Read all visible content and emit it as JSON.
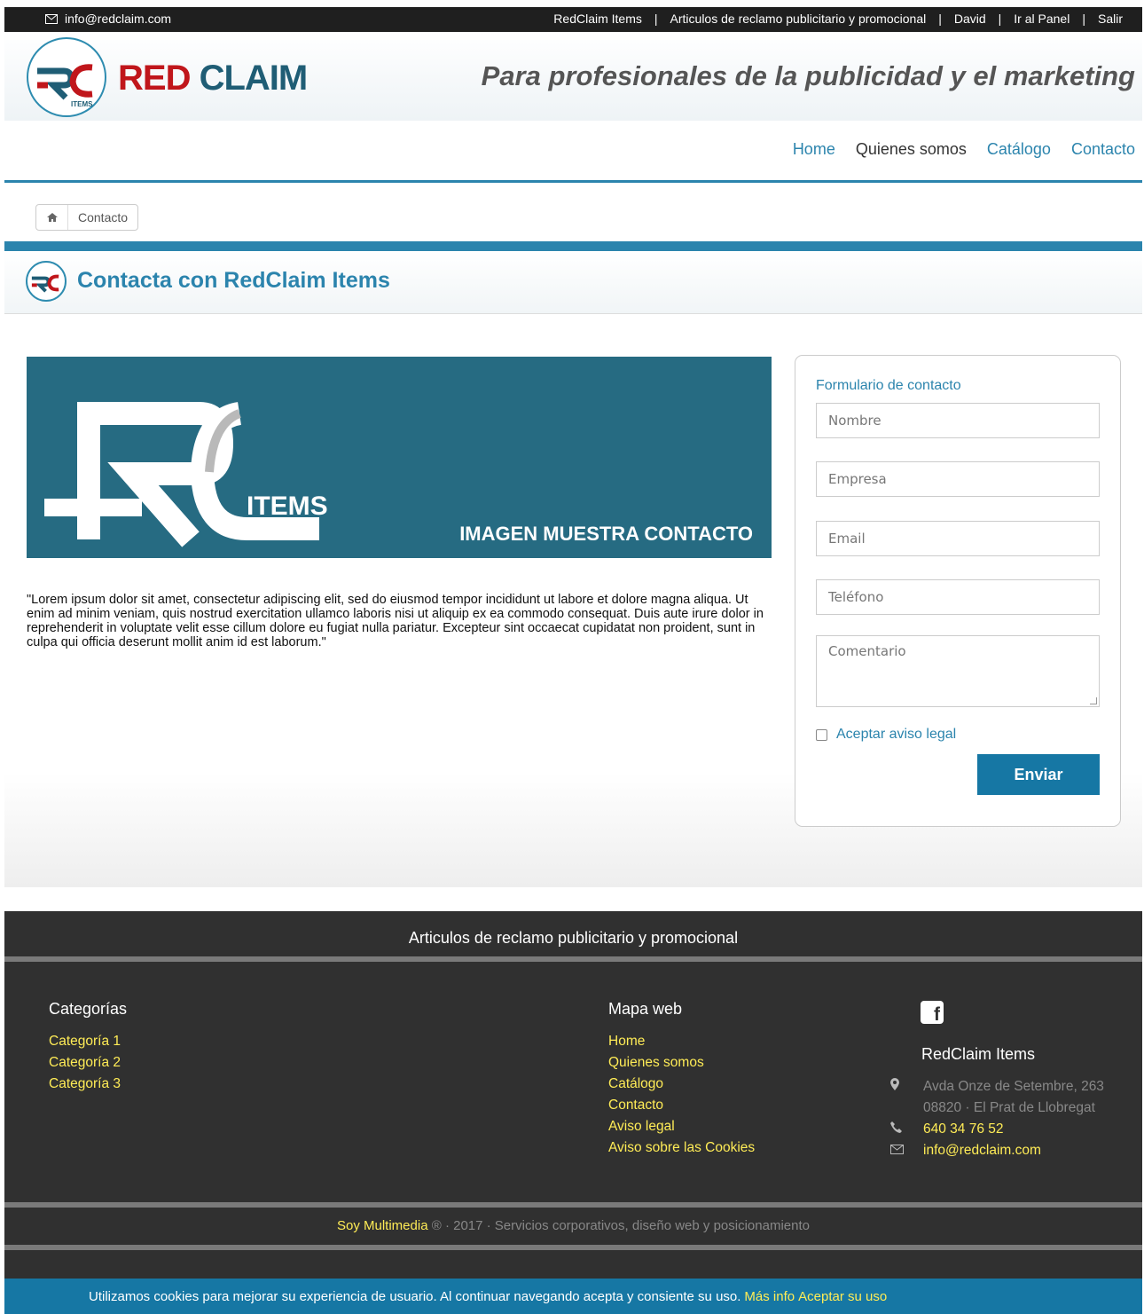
{
  "topbar": {
    "email": "info@redclaim.com",
    "links": [
      "RedClaim Items",
      "|",
      "Articulos de reclamo publicitario y promocional",
      "|",
      "David",
      "|",
      "Ir al Panel",
      "|",
      "Salir"
    ]
  },
  "header": {
    "logo_red": "RED",
    "logo_blue": "CLAIM",
    "logo_badge": "ITEMS",
    "tagline": "Para profesionales de la publicidad y el marketing"
  },
  "nav": {
    "items": [
      "Home",
      "Quienes somos",
      "Catálogo",
      "Contacto"
    ],
    "active_index": 1
  },
  "breadcrumb": {
    "current": "Contacto"
  },
  "page": {
    "title": "Contacta con RedClaim Items"
  },
  "banner": {
    "items_text": "ITEMS",
    "caption": "IMAGEN MUESTRA CONTACTO"
  },
  "lorem": "\"Lorem ipsum dolor sit amet, consectetur adipiscing elit, sed do eiusmod tempor incididunt ut labore et dolore magna aliqua. Ut enim ad minim veniam, quis nostrud exercitation ullamco laboris nisi ut aliquip ex ea commodo consequat. Duis aute irure dolor in reprehenderit in voluptate velit esse cillum dolore eu fugiat nulla pariatur. Excepteur sint occaecat cupidatat non proident, sunt in culpa qui officia deserunt mollit anim id est laborum.\"",
  "form": {
    "title": "Formulario de contacto",
    "nombre": "Nombre",
    "empresa": "Empresa",
    "email": "Email",
    "telefono": "Teléfono",
    "comentario": "Comentario",
    "legal": "Aceptar aviso legal",
    "submit": "Enviar"
  },
  "footer": {
    "band": "Articulos de reclamo publicitario y promocional",
    "categories_title": "Categorías",
    "categories": [
      "Categoría 1",
      "Categoría 2",
      "Categoría 3"
    ],
    "sitemap_title": "Mapa web",
    "sitemap": [
      "Home",
      "Quienes somos",
      "Catálogo",
      "Contacto",
      "Aviso legal",
      "Aviso sobre las Cookies"
    ],
    "company": "RedClaim Items",
    "address1": "Avda Onze de Setembre, 263",
    "address2": "08820 · El Prat de Llobregat",
    "phone": "640 34 76 52",
    "email": "info@redclaim.com",
    "copy_brand": "Soy Multimedia",
    "copy_rest": "® · 2017 · Servicios corporativos, diseño web y posicionamiento"
  },
  "cookies": {
    "text": "Utilizamos cookies para mejorar su experiencia de usuario. Al continuar navegando acepta y consiente su uso.",
    "more": "Más info",
    "accept": "Aceptar su uso"
  },
  "colors": {
    "accent": "#2b84ad",
    "brand_red": "#c0161b",
    "footer_link": "#ffec56",
    "button": "#1677a4"
  }
}
